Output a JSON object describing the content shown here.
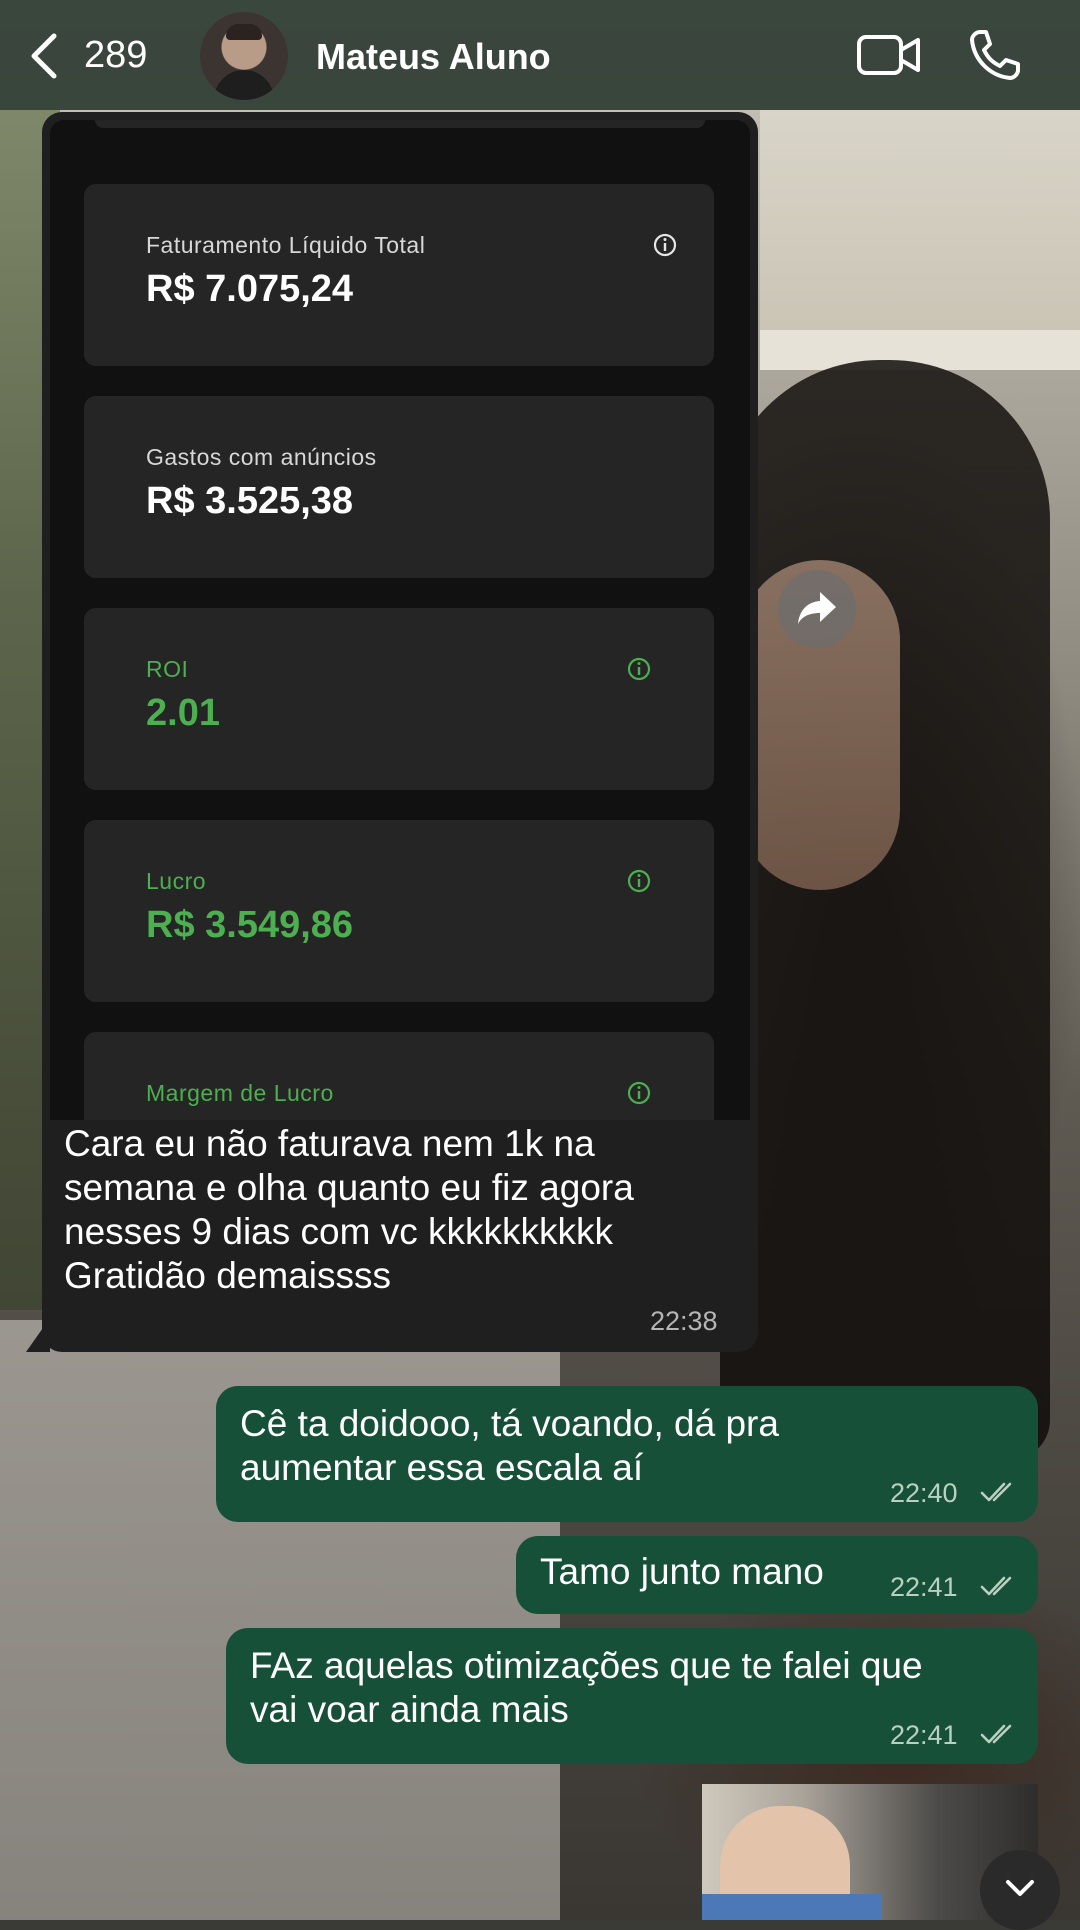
{
  "header": {
    "back_label": "289",
    "contact_name": "Mateus Aluno",
    "icons": [
      "chevron-left-icon",
      "video-camera-icon",
      "phone-icon"
    ]
  },
  "incoming": {
    "screenshot": {
      "metrics": [
        {
          "label": "Faturamento Líquido Total",
          "value": "R$ 7.075,24",
          "color": "#ffffff",
          "info": true
        },
        {
          "label": "Gastos com anúncios",
          "value": "R$ 3.525,38",
          "color": "#ffffff",
          "info": false
        },
        {
          "label": "ROI",
          "value": "2.01",
          "color": "#4caf50",
          "info": true
        },
        {
          "label": "Lucro",
          "value": "R$ 3.549,86",
          "color": "#4caf50",
          "info": true
        },
        {
          "label": "Margem de Lucro",
          "value": "",
          "color": "#4caf50",
          "info": true
        }
      ]
    },
    "text_lines": [
      "Cara eu não faturava nem 1k na",
      "semana e olha quanto eu fiz agora",
      "nesses 9 dias com vc kkkkkkkkkk",
      "Gratidão demaissss"
    ],
    "time": "22:38"
  },
  "outgoing": [
    {
      "lines": [
        "Cê ta doidooo, tá voando, dá pra",
        "aumentar essa escala aí"
      ],
      "time": "22:40",
      "status": "read"
    },
    {
      "lines": [
        "Tamo junto mano"
      ],
      "time": "22:41",
      "status": "read"
    },
    {
      "lines": [
        "FAz aquelas otimizações que te falei que",
        "vai voar ainda mais"
      ],
      "time": "22:41",
      "status": "read"
    }
  ],
  "colors": {
    "header_bg": "#2e3c32",
    "incoming_bubble": "#1f1f1f",
    "outgoing_bubble": "#165038",
    "metric_green": "#4caf50"
  }
}
